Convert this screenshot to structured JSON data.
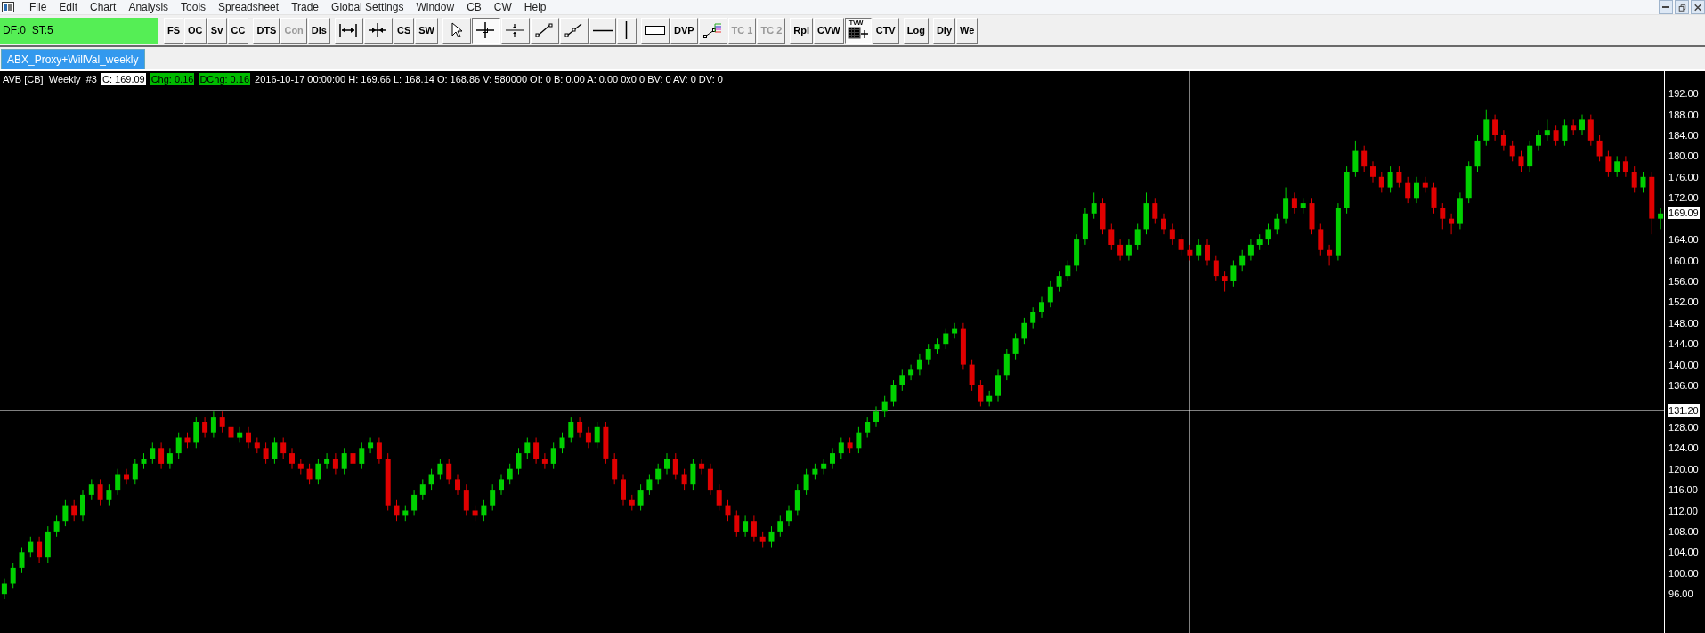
{
  "menu": [
    "File",
    "Edit",
    "Chart",
    "Analysis",
    "Tools",
    "Spreadsheet",
    "Trade",
    "Global Settings",
    "Window",
    "CB",
    "CW",
    "Help"
  ],
  "status_field": "DF:0  ST:5",
  "toolbar_groups": [
    [
      {
        "kind": "text",
        "label": "FS",
        "disabled": false,
        "selected": false
      },
      {
        "kind": "text",
        "label": "OC",
        "disabled": false,
        "selected": false
      },
      {
        "kind": "text",
        "label": "Sv",
        "disabled": false,
        "selected": false
      },
      {
        "kind": "text",
        "label": "CC",
        "disabled": false,
        "selected": false
      }
    ],
    [
      {
        "kind": "text",
        "label": "DTS",
        "disabled": false,
        "selected": false
      },
      {
        "kind": "text",
        "label": "Con",
        "disabled": true,
        "selected": false
      },
      {
        "kind": "text",
        "label": "Dis",
        "disabled": false,
        "selected": false
      }
    ],
    [
      {
        "kind": "expand",
        "disabled": false,
        "selected": false
      },
      {
        "kind": "compress",
        "disabled": false,
        "selected": false
      },
      {
        "kind": "text",
        "label": "CS",
        "disabled": false,
        "selected": false
      },
      {
        "kind": "text",
        "label": "SW",
        "disabled": false,
        "selected": false
      }
    ],
    [
      {
        "kind": "pointer",
        "disabled": false,
        "selected": false
      },
      {
        "kind": "crosshair",
        "disabled": false,
        "selected": true
      },
      {
        "kind": "hcross",
        "disabled": false,
        "selected": false
      },
      {
        "kind": "line",
        "disabled": false,
        "selected": false
      },
      {
        "kind": "ray",
        "disabled": false,
        "selected": false
      },
      {
        "kind": "hline",
        "disabled": false,
        "selected": false
      },
      {
        "kind": "vline",
        "disabled": false,
        "selected": false
      }
    ],
    [
      {
        "kind": "rect",
        "disabled": false,
        "selected": false
      },
      {
        "kind": "text",
        "label": "DVP",
        "disabled": false,
        "selected": false
      },
      {
        "kind": "fan",
        "disabled": false,
        "selected": false
      },
      {
        "kind": "text",
        "label": "TC 1",
        "disabled": true,
        "selected": false
      },
      {
        "kind": "text",
        "label": "TC 2",
        "disabled": true,
        "selected": false
      }
    ],
    [
      {
        "kind": "text",
        "label": "Rpl",
        "disabled": false,
        "selected": false
      },
      {
        "kind": "text",
        "label": "CVW",
        "disabled": false,
        "selected": false
      },
      {
        "kind": "grid",
        "label": "TVW",
        "disabled": false,
        "selected": true
      },
      {
        "kind": "text",
        "label": "CTV",
        "disabled": false,
        "selected": false
      }
    ],
    [
      {
        "kind": "text",
        "label": "Log",
        "disabled": false,
        "selected": false
      }
    ],
    [
      {
        "kind": "text",
        "label": "Dly",
        "disabled": false,
        "selected": false
      },
      {
        "kind": "text",
        "label": "We",
        "disabled": false,
        "selected": false
      }
    ]
  ],
  "tabs": [
    {
      "label": "ABX_Proxy+WillVal_weekly",
      "selected": true
    }
  ],
  "info_line": [
    {
      "kind": "plain",
      "text": "AVB [CB]  Weekly  #3"
    },
    {
      "kind": "close",
      "text": "C: 169.09"
    },
    {
      "kind": "change",
      "text": "Chg: 0.16"
    },
    {
      "kind": "change",
      "text": "DChg: 0.16"
    },
    {
      "kind": "plain",
      "text": "2016-10-17 00:00:00 H: 169.66 L: 168.14 O: 168.86 V: 580000 OI: 0 B: 0.00 A: 0.00 0x0 0 BV: 0 AV: 0 DV: 0"
    }
  ],
  "chart_data": {
    "type": "candlestick",
    "ylim": [
      88,
      196.3
    ],
    "yticks": [
      {
        "value": 192,
        "label": "192.00"
      },
      {
        "value": 188,
        "label": "188.00"
      },
      {
        "value": 184,
        "label": "184.00"
      },
      {
        "value": 180,
        "label": "180.00"
      },
      {
        "value": 176,
        "label": "176.00"
      },
      {
        "value": 172,
        "label": "172.00"
      },
      {
        "value": 164,
        "label": "164.00"
      },
      {
        "value": 160,
        "label": "160.00"
      },
      {
        "value": 156,
        "label": "156.00"
      },
      {
        "value": 152,
        "label": "152.00"
      },
      {
        "value": 148,
        "label": "148.00"
      },
      {
        "value": 144,
        "label": "144.00"
      },
      {
        "value": 140,
        "label": "140.00"
      },
      {
        "value": 136,
        "label": "136.00"
      },
      {
        "value": 128,
        "label": "128.00"
      },
      {
        "value": 124,
        "label": "124.00"
      },
      {
        "value": 120,
        "label": "120.00"
      },
      {
        "value": 116,
        "label": "116.00"
      },
      {
        "value": 112,
        "label": "112.00"
      },
      {
        "value": 108,
        "label": "108.00"
      },
      {
        "value": 104,
        "label": "104.00"
      },
      {
        "value": 100,
        "label": "100.00"
      },
      {
        "value": 96,
        "label": "96.00"
      }
    ],
    "ohlc": [
      [
        96,
        99,
        95,
        98
      ],
      [
        98,
        102,
        97,
        101
      ],
      [
        101,
        105,
        100,
        104
      ],
      [
        104,
        107,
        103,
        106
      ],
      [
        106,
        107,
        102,
        103
      ],
      [
        103,
        109,
        102,
        108
      ],
      [
        108,
        111,
        107,
        110
      ],
      [
        110,
        114,
        109,
        113
      ],
      [
        113,
        114,
        110,
        111
      ],
      [
        111,
        116,
        110,
        115
      ],
      [
        115,
        118,
        114,
        117
      ],
      [
        117,
        118,
        113,
        114
      ],
      [
        114,
        117,
        113,
        116
      ],
      [
        116,
        120,
        115,
        119
      ],
      [
        119,
        120,
        117,
        118
      ],
      [
        118,
        122,
        117,
        121
      ],
      [
        121,
        123,
        120,
        122
      ],
      [
        122,
        125,
        121,
        124
      ],
      [
        124,
        125,
        120,
        121
      ],
      [
        121,
        124,
        120,
        123
      ],
      [
        123,
        127,
        122,
        126
      ],
      [
        126,
        127,
        124,
        125
      ],
      [
        125,
        130,
        124,
        129
      ],
      [
        129,
        130,
        126,
        127
      ],
      [
        127,
        131,
        126,
        130
      ],
      [
        130,
        131,
        127,
        128
      ],
      [
        128,
        129,
        125,
        126
      ],
      [
        126,
        128,
        125,
        127
      ],
      [
        127,
        128,
        124,
        125
      ],
      [
        125,
        126,
        123,
        124
      ],
      [
        124,
        125,
        121,
        122
      ],
      [
        122,
        126,
        121,
        125
      ],
      [
        125,
        126,
        122,
        123
      ],
      [
        123,
        124,
        120,
        121
      ],
      [
        121,
        122,
        119,
        120
      ],
      [
        120,
        121,
        117,
        118
      ],
      [
        118,
        122,
        117,
        121
      ],
      [
        121,
        123,
        120,
        122
      ],
      [
        122,
        123,
        119,
        120
      ],
      [
        120,
        124,
        119,
        123
      ],
      [
        123,
        124,
        120,
        121
      ],
      [
        121,
        125,
        120,
        124
      ],
      [
        124,
        126,
        123,
        125
      ],
      [
        125,
        126,
        121,
        122
      ],
      [
        122,
        123,
        112,
        113
      ],
      [
        113,
        114,
        110,
        111
      ],
      [
        111,
        113,
        110,
        112
      ],
      [
        112,
        116,
        111,
        115
      ],
      [
        115,
        118,
        114,
        117
      ],
      [
        117,
        120,
        116,
        119
      ],
      [
        119,
        122,
        118,
        121
      ],
      [
        121,
        122,
        117,
        118
      ],
      [
        118,
        119,
        115,
        116
      ],
      [
        116,
        117,
        111,
        112
      ],
      [
        112,
        113,
        110,
        111
      ],
      [
        111,
        114,
        110,
        113
      ],
      [
        113,
        117,
        112,
        116
      ],
      [
        116,
        119,
        115,
        118
      ],
      [
        118,
        121,
        117,
        120
      ],
      [
        120,
        124,
        119,
        123
      ],
      [
        123,
        126,
        122,
        125
      ],
      [
        125,
        126,
        121,
        122
      ],
      [
        122,
        123,
        120,
        121
      ],
      [
        121,
        125,
        120,
        124
      ],
      [
        124,
        127,
        123,
        126
      ],
      [
        126,
        130,
        125,
        129
      ],
      [
        129,
        130,
        126,
        127
      ],
      [
        127,
        128,
        124,
        125
      ],
      [
        125,
        129,
        124,
        128
      ],
      [
        128,
        129,
        121,
        122
      ],
      [
        122,
        123,
        117,
        118
      ],
      [
        118,
        119,
        113,
        114
      ],
      [
        114,
        115,
        112,
        113
      ],
      [
        113,
        117,
        112,
        116
      ],
      [
        116,
        119,
        115,
        118
      ],
      [
        118,
        121,
        117,
        120
      ],
      [
        120,
        123,
        119,
        122
      ],
      [
        122,
        123,
        118,
        119
      ],
      [
        119,
        120,
        116,
        117
      ],
      [
        117,
        122,
        116,
        121
      ],
      [
        121,
        122,
        119,
        120
      ],
      [
        120,
        121,
        115,
        116
      ],
      [
        116,
        117,
        112,
        113
      ],
      [
        113,
        114,
        110,
        111
      ],
      [
        111,
        112,
        107,
        108
      ],
      [
        108,
        111,
        107,
        110
      ],
      [
        110,
        111,
        106,
        107
      ],
      [
        107,
        108,
        105,
        106
      ],
      [
        106,
        109,
        105,
        108
      ],
      [
        108,
        111,
        107,
        110
      ],
      [
        110,
        113,
        109,
        112
      ],
      [
        112,
        117,
        111,
        116
      ],
      [
        116,
        120,
        115,
        119
      ],
      [
        119,
        121,
        118,
        120
      ],
      [
        120,
        122,
        119,
        121
      ],
      [
        121,
        124,
        120,
        123
      ],
      [
        123,
        126,
        122,
        125
      ],
      [
        125,
        126,
        123,
        124
      ],
      [
        124,
        128,
        123,
        127
      ],
      [
        127,
        130,
        126,
        129
      ],
      [
        129,
        132,
        128,
        131
      ],
      [
        131,
        134,
        130,
        133
      ],
      [
        133,
        137,
        132,
        136
      ],
      [
        136,
        139,
        135,
        138
      ],
      [
        138,
        140,
        137,
        139
      ],
      [
        139,
        142,
        138,
        141
      ],
      [
        141,
        144,
        140,
        143
      ],
      [
        143,
        145,
        142,
        144
      ],
      [
        144,
        147,
        143,
        146
      ],
      [
        146,
        148,
        145,
        147
      ],
      [
        147,
        148,
        139,
        140
      ],
      [
        140,
        141,
        135,
        136
      ],
      [
        136,
        137,
        132,
        133
      ],
      [
        133,
        135,
        132,
        134
      ],
      [
        134,
        139,
        133,
        138
      ],
      [
        138,
        143,
        137,
        142
      ],
      [
        142,
        146,
        141,
        145
      ],
      [
        145,
        149,
        144,
        148
      ],
      [
        148,
        151,
        147,
        150
      ],
      [
        150,
        153,
        149,
        152
      ],
      [
        152,
        156,
        151,
        155
      ],
      [
        155,
        158,
        154,
        157
      ],
      [
        157,
        160,
        156,
        159
      ],
      [
        159,
        165,
        158,
        164
      ],
      [
        164,
        170,
        163,
        169
      ],
      [
        169,
        173,
        168,
        171
      ],
      [
        171,
        172,
        165,
        166
      ],
      [
        166,
        167,
        162,
        163
      ],
      [
        163,
        164,
        160,
        161
      ],
      [
        161,
        164,
        160,
        163
      ],
      [
        163,
        167,
        162,
        166
      ],
      [
        166,
        173,
        165,
        171
      ],
      [
        171,
        172,
        167,
        168
      ],
      [
        168,
        169,
        165,
        166
      ],
      [
        166,
        167,
        163,
        164
      ],
      [
        164,
        165,
        161,
        162
      ],
      [
        162,
        163,
        160,
        161
      ],
      [
        161,
        164,
        160,
        163
      ],
      [
        163,
        164,
        159,
        160
      ],
      [
        160,
        161,
        156,
        157
      ],
      [
        157,
        158,
        154,
        156
      ],
      [
        156,
        160,
        155,
        159
      ],
      [
        159,
        162,
        158,
        161
      ],
      [
        161,
        164,
        160,
        163
      ],
      [
        163,
        165,
        162,
        164
      ],
      [
        164,
        167,
        163,
        166
      ],
      [
        166,
        169,
        165,
        168
      ],
      [
        168,
        174,
        167,
        172
      ],
      [
        172,
        173,
        169,
        170
      ],
      [
        170,
        172,
        169,
        171
      ],
      [
        171,
        172,
        165,
        166
      ],
      [
        166,
        167,
        161,
        162
      ],
      [
        162,
        163,
        159,
        161
      ],
      [
        161,
        171,
        160,
        170
      ],
      [
        170,
        178,
        169,
        177
      ],
      [
        177,
        183,
        176,
        181
      ],
      [
        181,
        182,
        177,
        178
      ],
      [
        178,
        179,
        175,
        176
      ],
      [
        176,
        177,
        173,
        174
      ],
      [
        174,
        178,
        173,
        177
      ],
      [
        177,
        178,
        174,
        175
      ],
      [
        175,
        176,
        171,
        172
      ],
      [
        172,
        176,
        171,
        175
      ],
      [
        175,
        176,
        173,
        174
      ],
      [
        174,
        175,
        169,
        170
      ],
      [
        170,
        171,
        166,
        168
      ],
      [
        168,
        169,
        165,
        167
      ],
      [
        167,
        173,
        166,
        172
      ],
      [
        172,
        179,
        171,
        178
      ],
      [
        178,
        184,
        177,
        183
      ],
      [
        183,
        189,
        182,
        187
      ],
      [
        187,
        188,
        183,
        184
      ],
      [
        184,
        185,
        181,
        182
      ],
      [
        182,
        183,
        179,
        180
      ],
      [
        180,
        181,
        177,
        178
      ],
      [
        178,
        183,
        177,
        182
      ],
      [
        182,
        185,
        181,
        184
      ],
      [
        184,
        187,
        183,
        185
      ],
      [
        185,
        186,
        182,
        183
      ],
      [
        183,
        187,
        182,
        186
      ],
      [
        186,
        187,
        184,
        185
      ],
      [
        185,
        188,
        184,
        187
      ],
      [
        187,
        188,
        182,
        183
      ],
      [
        183,
        184,
        179,
        180
      ],
      [
        180,
        181,
        176,
        177
      ],
      [
        177,
        180,
        176,
        179
      ],
      [
        179,
        180,
        176,
        177
      ],
      [
        177,
        178,
        173,
        174
      ],
      [
        174,
        177,
        173,
        176
      ],
      [
        176,
        177,
        165,
        168
      ],
      [
        168,
        170,
        166,
        169
      ]
    ]
  },
  "last_price_label": "169.09",
  "crosshair_label": "131.20"
}
